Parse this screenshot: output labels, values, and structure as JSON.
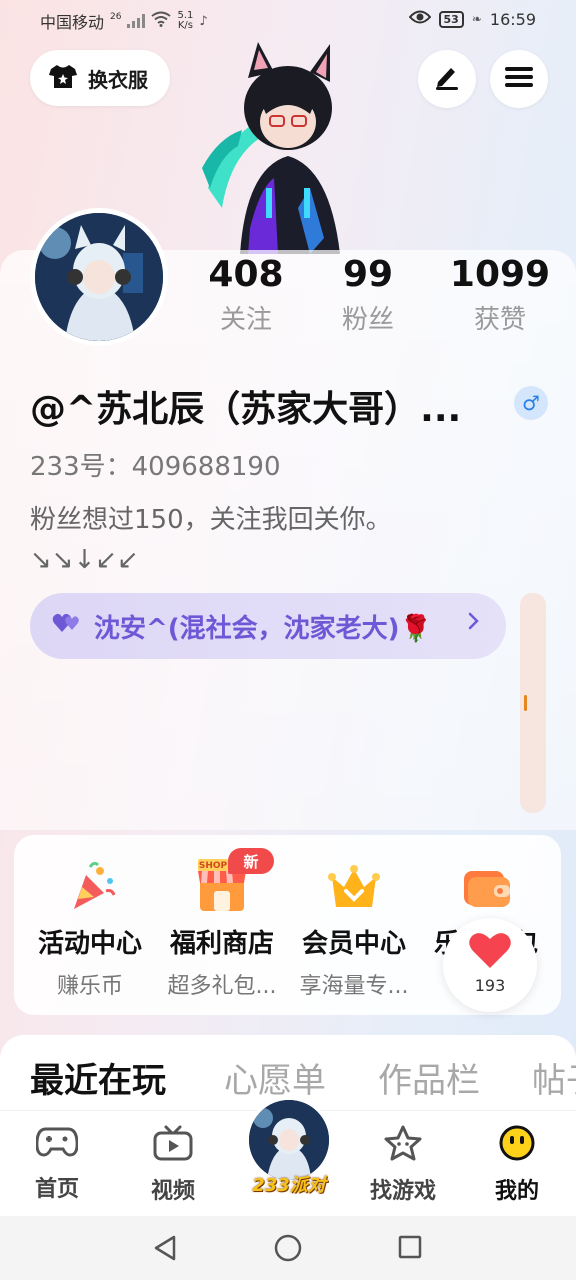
{
  "status_bar": {
    "carrier": "中国移动",
    "network_type": "26",
    "net_speed_value": "5.1",
    "net_speed_unit": "K/s",
    "battery": "53",
    "time": "16:59"
  },
  "header": {
    "outfit_button_label": "换衣服",
    "edit_icon": "pen-icon",
    "menu_icon": "hamburger-menu-icon"
  },
  "stats": [
    {
      "value": "408",
      "label": "关注"
    },
    {
      "value": "99",
      "label": "粉丝"
    },
    {
      "value": "1099",
      "label": "获赞"
    }
  ],
  "profile": {
    "username": "@^苏北辰（苏家大哥）...",
    "gender_symbol": "♂",
    "uid": "233号：409688190",
    "bio_line1": "粉丝想过150，关注我回关你。",
    "bio_line2": "↘↘↓↙↙",
    "relation": "沈安^(混社会，沈家老大)🌹"
  },
  "features": [
    {
      "title": "活动中心",
      "subtitle": "赚乐币",
      "icon": "party-popper-icon"
    },
    {
      "title": "福利商店",
      "subtitle": "超多礼包...",
      "icon": "shop-icon"
    },
    {
      "title": "会员中心",
      "subtitle": "享海量专...",
      "icon": "crown-icon"
    },
    {
      "title": "乐币钱包",
      "subtitle": "",
      "icon": "wallet-icon"
    }
  ],
  "feature_badge": "新",
  "shop_sign": "SHOP",
  "like_count": "193",
  "tabs": [
    "最近在玩",
    "心愿单",
    "作品栏",
    "帖子"
  ],
  "bottom_nav": [
    {
      "label": "首页",
      "icon": "gamepad-icon"
    },
    {
      "label": "视频",
      "icon": "tv-icon"
    },
    {
      "label": "233派对",
      "icon": "party-avatar-icon"
    },
    {
      "label": "找游戏",
      "icon": "star-icon"
    },
    {
      "label": "我的",
      "icon": "smiley-icon"
    }
  ],
  "colors": {
    "accent_purple": "#6f58d6",
    "gender_blue": "#2a80e6",
    "badge_red": "#f04a4a"
  }
}
